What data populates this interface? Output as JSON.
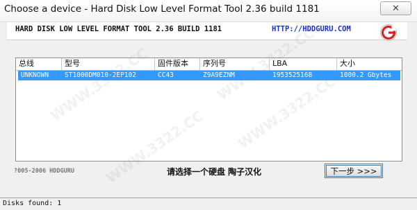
{
  "window": {
    "title": "Choose a device - Hard Disk Low Level Format Tool 2.36 build 1181",
    "close_symbol": "✕"
  },
  "banner": {
    "title": "HARD DISK LOW LEVEL FORMAT TOOL 2.36 BUILD 1181",
    "url": "HTTP://HDDGURU.COM",
    "logo_icon": "hddguru-logo-icon"
  },
  "device_list": {
    "columns": [
      "总线",
      "型号",
      "固件版本",
      "序列号",
      "LBA",
      "大小"
    ],
    "rows": [
      {
        "bus": "UNKNOWN",
        "model": "ST1000DM010-2EP102",
        "firmware": "CC43",
        "serial": "Z9A9EZNM",
        "lba": "1953525168",
        "size": "1000.2 Gbytes"
      }
    ]
  },
  "footer": {
    "copyright": "?005-2006 HDDGURU",
    "instruction": "请选择一个硬盘   陶子汉化",
    "next_button": "下一步 >>>"
  },
  "statusbar": {
    "text": "Disks found: 1"
  },
  "watermark": {
    "text": "WWW.3322.CC"
  },
  "colors": {
    "selection": "#3399ff",
    "url": "#1a2fd0",
    "logo_red": "#d8231f"
  }
}
